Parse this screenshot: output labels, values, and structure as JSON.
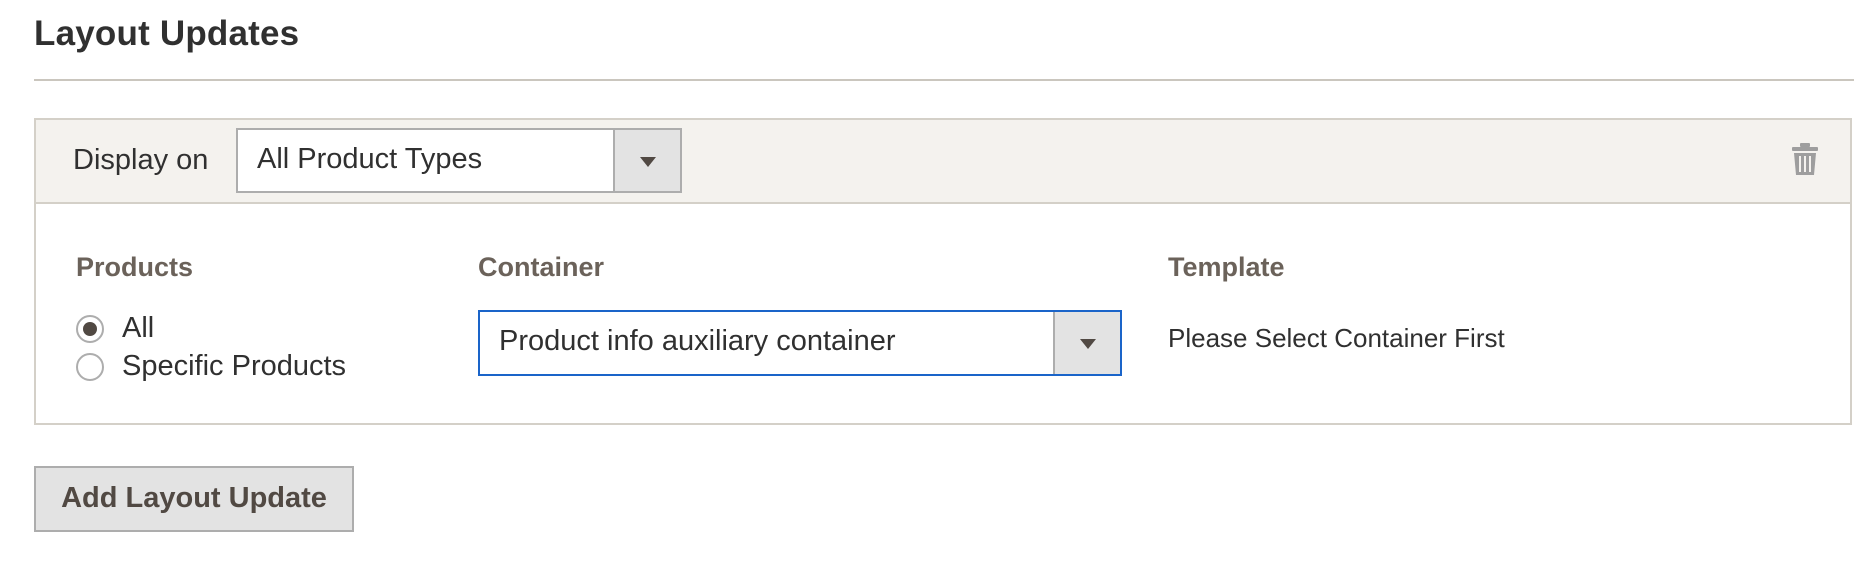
{
  "section": {
    "title": "Layout Updates"
  },
  "layout_update": {
    "display_on_label": "Display on",
    "display_on_value": "All Product Types",
    "delete_icon": "trash-icon",
    "products": {
      "label": "Products",
      "options": [
        {
          "label": "All",
          "checked": true
        },
        {
          "label": "Specific Products",
          "checked": false
        }
      ]
    },
    "container": {
      "label": "Container",
      "value": "Product info auxiliary container"
    },
    "template": {
      "label": "Template",
      "message": "Please Select Container First"
    }
  },
  "actions": {
    "add_label": "Add Layout Update"
  },
  "colors": {
    "focus_border": "#1a64c9",
    "header_bg": "#f4f2ee",
    "label_text": "#6b625a"
  }
}
